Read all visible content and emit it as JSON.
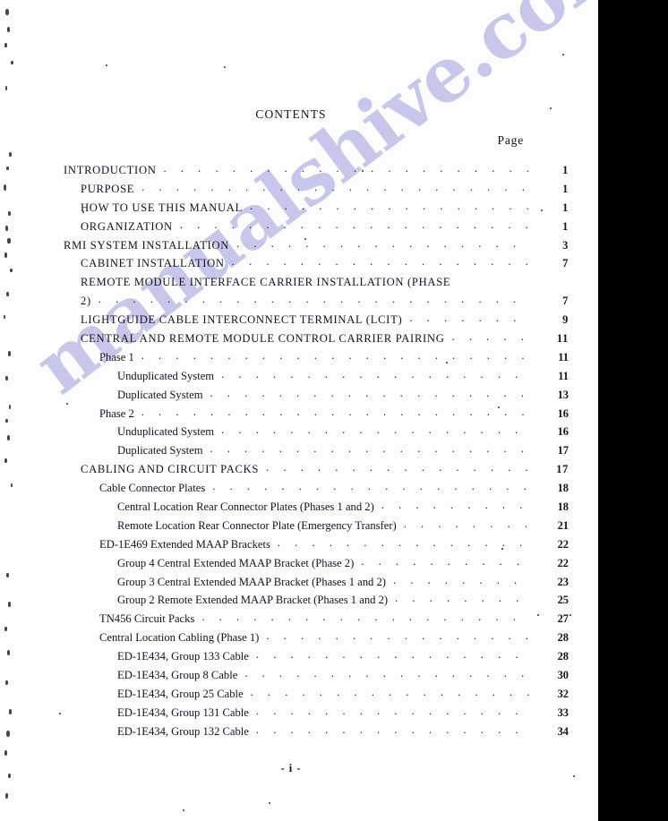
{
  "document": {
    "title": "CONTENTS",
    "page_column_header": "Page",
    "folio": "- i -",
    "watermark": "manualshive.com",
    "watermark_color": "#c6c4ea"
  },
  "toc": {
    "dot_leader": ". . . . . . . . . . . . . . . . . . . . . . . . . . . . . . . . . . . . . . . . . . . . . . . . . . .",
    "entries": [
      {
        "label": "INTRODUCTION",
        "page": "1",
        "level": 0,
        "caps": true
      },
      {
        "label": "PURPOSE",
        "page": "1",
        "level": 1,
        "caps": true
      },
      {
        "label": "HOW TO USE THIS MANUAL",
        "page": "1",
        "level": 1,
        "caps": true
      },
      {
        "label": "ORGANIZATION",
        "page": "1",
        "level": 1,
        "caps": true
      },
      {
        "label": "RMI SYSTEM INSTALLATION",
        "page": "3",
        "level": 0,
        "caps": true
      },
      {
        "label": "CABINET INSTALLATION",
        "page": "7",
        "level": 1,
        "caps": true
      },
      {
        "label": "REMOTE MODULE INTERFACE CARRIER INSTALLATION (PHASE",
        "page": "",
        "level": 1,
        "caps": true,
        "wrap_head": true
      },
      {
        "label": "2)",
        "page": "7",
        "level": 1,
        "caps": true
      },
      {
        "label": "LIGHTGUIDE CABLE INTERCONNECT TERMINAL (LCIT)",
        "page": "9",
        "level": 1,
        "caps": true
      },
      {
        "label": "CENTRAL AND REMOTE MODULE CONTROL CARRIER PAIRING",
        "page": "11",
        "level": 1,
        "caps": true
      },
      {
        "label": "Phase 1",
        "page": "11",
        "level": 2,
        "caps": false
      },
      {
        "label": "Unduplicated System",
        "page": "11",
        "level": 3,
        "caps": false
      },
      {
        "label": "Duplicated System",
        "page": "13",
        "level": 3,
        "caps": false
      },
      {
        "label": "Phase 2",
        "page": "16",
        "level": 2,
        "caps": false
      },
      {
        "label": "Unduplicated System",
        "page": "16",
        "level": 3,
        "caps": false
      },
      {
        "label": "Duplicated System",
        "page": "17",
        "level": 3,
        "caps": false
      },
      {
        "label": "CABLING AND CIRCUIT PACKS",
        "page": "17",
        "level": 1,
        "caps": true
      },
      {
        "label": "Cable Connector Plates",
        "page": "18",
        "level": 2,
        "caps": false
      },
      {
        "label": "Central Location Rear Connector Plates (Phases 1 and 2)",
        "page": "18",
        "level": 3,
        "caps": false
      },
      {
        "label": "Remote Location Rear Connector Plate (Emergency Transfer)",
        "page": "21",
        "level": 3,
        "caps": false
      },
      {
        "label": "ED-1E469 Extended MAAP Brackets",
        "page": "22",
        "level": 2,
        "caps": false
      },
      {
        "label": "Group 4 Central Extended MAAP Bracket (Phase 2)",
        "page": "22",
        "level": 3,
        "caps": false
      },
      {
        "label": "Group 3 Central Extended MAAP Bracket (Phases 1 and 2)",
        "page": "23",
        "level": 3,
        "caps": false
      },
      {
        "label": "Group 2 Remote Extended MAAP Bracket (Phases 1 and 2)",
        "page": "25",
        "level": 3,
        "caps": false
      },
      {
        "label": "TN456 Circuit Packs",
        "page": "27",
        "level": 2,
        "caps": false
      },
      {
        "label": "Central Location Cabling (Phase 1)",
        "page": "28",
        "level": 2,
        "caps": false
      },
      {
        "label": "ED-1E434, Group 133 Cable",
        "page": "28",
        "level": 3,
        "caps": false
      },
      {
        "label": "ED-1E434, Group 8 Cable",
        "page": "30",
        "level": 3,
        "caps": false
      },
      {
        "label": "ED-1E434, Group 25 Cable",
        "page": "32",
        "level": 3,
        "caps": false
      },
      {
        "label": "ED-1E434, Group 131 Cable",
        "page": "33",
        "level": 3,
        "caps": false
      },
      {
        "label": "ED-1E434, Group 132 Cable",
        "page": "34",
        "level": 3,
        "caps": false
      }
    ]
  }
}
